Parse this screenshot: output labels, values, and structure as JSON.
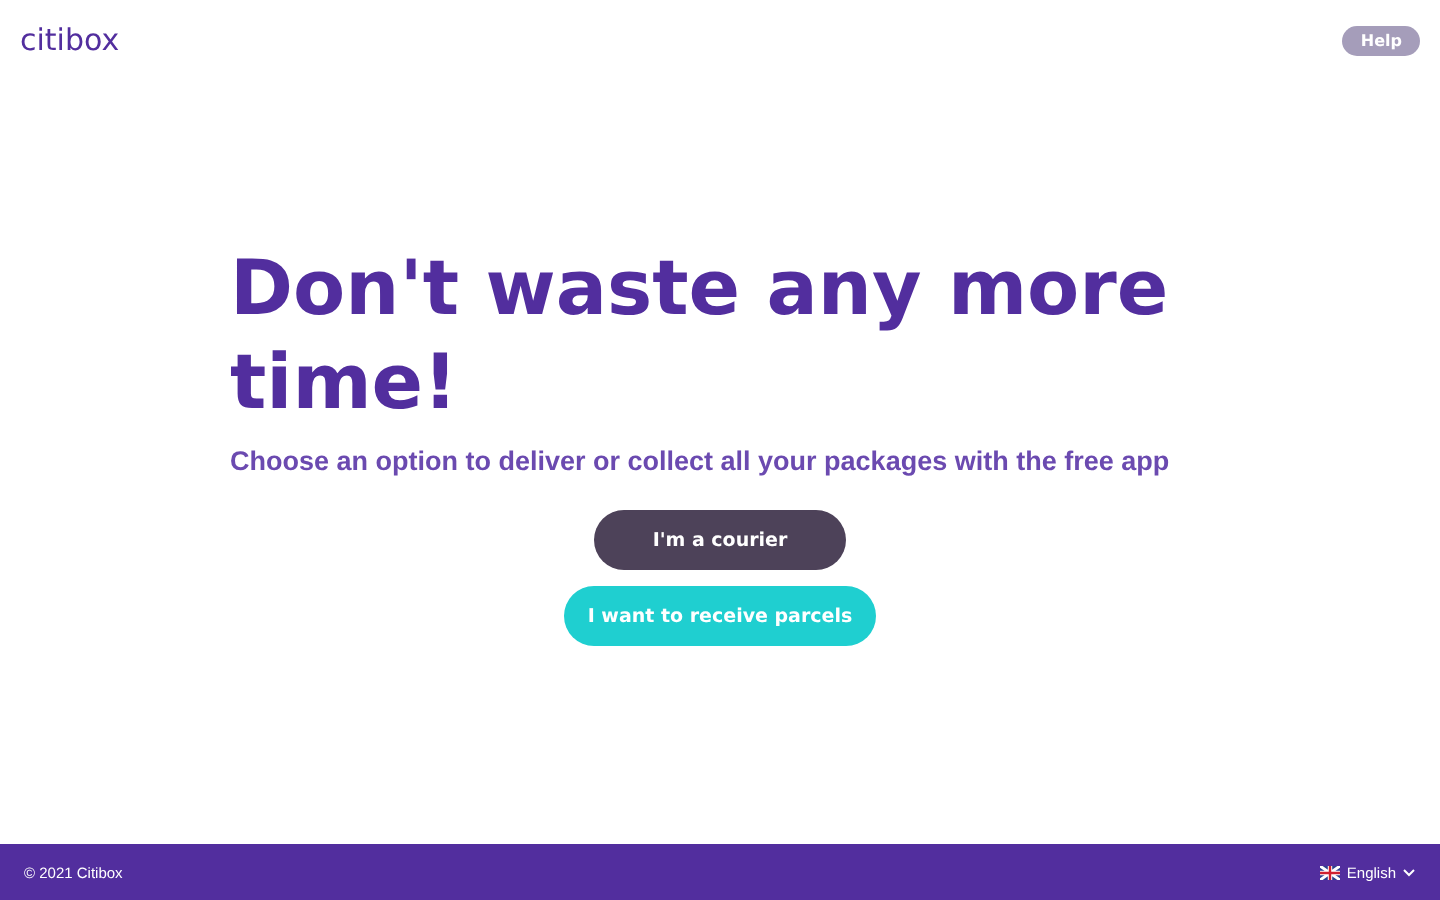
{
  "header": {
    "logo": "citibox",
    "help_button": "Help"
  },
  "hero": {
    "title": "Don't waste any more time!",
    "subtitle": "Choose an option to deliver or collect all your packages with the free app"
  },
  "buttons": [
    {
      "label": "I'm a courier",
      "kind": "dark"
    },
    {
      "label": "I want to receive parcels",
      "kind": "accent"
    }
  ],
  "footer": {
    "copyright": "© 2021 Citibox",
    "language": "English"
  }
}
